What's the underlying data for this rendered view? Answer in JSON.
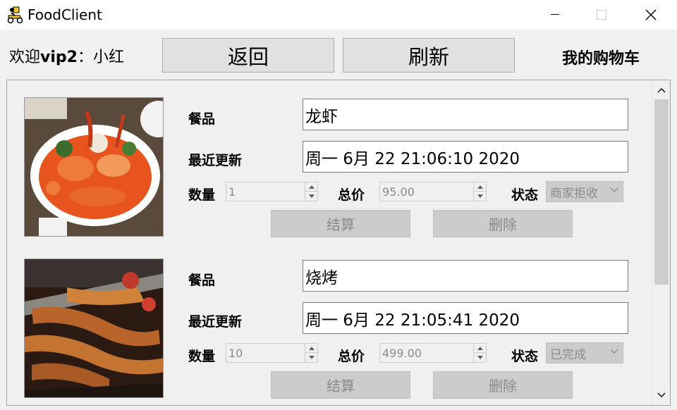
{
  "window": {
    "title": "FoodClient",
    "app_icon": "delivery-scooter-icon",
    "controls": [
      "minimize-icon",
      "maximize-icon",
      "close-icon"
    ]
  },
  "toolbar": {
    "welcome_prefix": "欢迎",
    "username": "vip2",
    "welcome_suffix": "：小红",
    "back_label": "返回",
    "refresh_label": "刷新",
    "cart_label": "我的购物车"
  },
  "labels": {
    "food": "餐品",
    "updated": "最近更新",
    "quantity": "数量",
    "total": "总价",
    "status": "状态",
    "checkout": "结算",
    "delete": "删除"
  },
  "orders": [
    {
      "food": "龙虾",
      "updated": "周一 6月 22 21:06:10 2020",
      "quantity": "1",
      "total": "95.00",
      "status": "商家拒收",
      "image": "lobster-dish-image"
    },
    {
      "food": "烧烤",
      "updated": "周一 6月 22 21:05:41 2020",
      "quantity": "10",
      "total": "499.00",
      "status": "已完成",
      "image": "barbecue-image"
    }
  ],
  "colors": {
    "window_bg": "#f0f0f0",
    "button_bg": "#e1e1e1",
    "disabled_bg": "#cccccc",
    "disabled_text": "#8a8a8a",
    "field_border": "#7a7a7a"
  }
}
